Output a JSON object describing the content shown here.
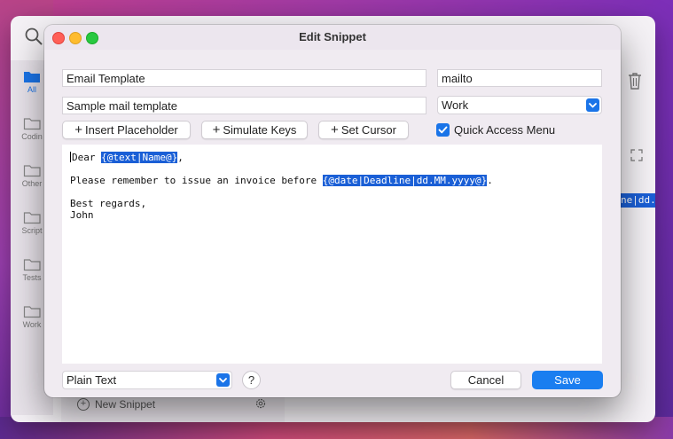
{
  "dialog": {
    "title": "Edit Snippet",
    "name_value": "Email Template",
    "abbreviation_value": "mailto",
    "description_value": "Sample mail template",
    "group_value": "Work",
    "buttons": {
      "insert_placeholder": "Insert Placeholder",
      "simulate_keys": "Simulate Keys",
      "set_cursor": "Set Cursor"
    },
    "quick_access_label": "Quick Access Menu",
    "quick_access_checked": true,
    "editor": {
      "line1_prefix": "Dear ",
      "line1_placeholder": "{@text|Name@}",
      "line1_suffix": ",",
      "line2_prefix": "Please remember to issue an invoice before ",
      "line2_placeholder": "{@date|Deadline|dd.MM.yyyy@}",
      "line2_suffix": ".",
      "line3": "Best regards,",
      "line4": "John"
    },
    "format_value": "Plain Text",
    "help_label": "?",
    "cancel_label": "Cancel",
    "save_label": "Save"
  },
  "background": {
    "sidebar": [
      {
        "label": "All",
        "active": true
      },
      {
        "label": "Codin",
        "active": false
      },
      {
        "label": "Other",
        "active": false
      },
      {
        "label": "Script",
        "active": false
      },
      {
        "label": "Tests",
        "active": false
      },
      {
        "label": "Work",
        "active": false
      }
    ],
    "new_snippet_label": "New Snippet",
    "highlight_fragment": "ne|dd."
  },
  "colors": {
    "accent": "#1a74e8",
    "placeholder_highlight": "#1a5fd6",
    "dialog_bg": "#f0ebf1"
  }
}
